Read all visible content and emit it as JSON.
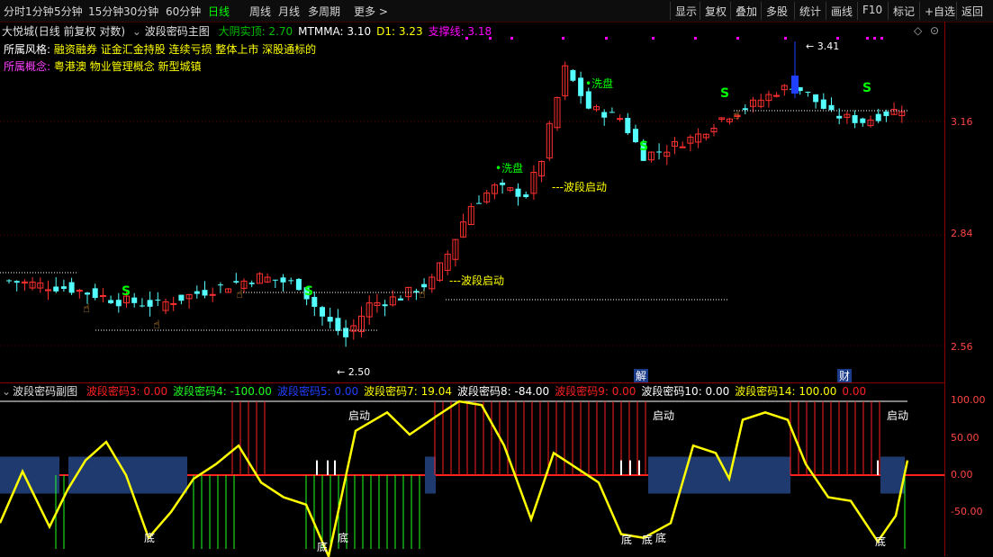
{
  "toolbar": {
    "left_items": [
      "分时",
      "1分钟",
      "5分钟",
      "15分钟",
      "30分钟",
      "60分钟",
      "日线",
      "周线",
      "月线",
      "多周期",
      "更多 >"
    ],
    "active": "日线",
    "right_items": [
      "显示",
      "复权",
      "叠加",
      "多股",
      "统计",
      "画线",
      "F10",
      "标记",
      "+自选",
      "返回"
    ]
  },
  "main": {
    "stock_name": "大悦城",
    "mode": "(日线 前复权 对数)",
    "indicator_name": "波段密码主图",
    "values": [
      {
        "label": "大阴实顶: 2.70",
        "color": "#00c000"
      },
      {
        "label": "MTMMA: 3.10",
        "color": "#ffffff"
      },
      {
        "label": "D1: 3.23",
        "color": "#ffff00"
      },
      {
        "label": "支撑线: 3.18",
        "color": "#ff00ff"
      }
    ],
    "style_label": "所属风格:",
    "style_value": "融资融券 证金汇金持股 连续亏损 整体上市 深股通标的",
    "concept_label": "所属概念:",
    "concept_value": "粤港澳 物业管理概念 新型城镇",
    "price_ticks": [
      "3.16",
      "2.84",
      "2.56"
    ],
    "high_label": "3.41",
    "low_label": "2.50",
    "annotations": {
      "start1": "---波段启动",
      "start2": "---波段启动",
      "wash1": "洗盘",
      "wash2": "洗盘",
      "s_mark": "S",
      "jie": "解",
      "cai": "财"
    }
  },
  "sub": {
    "title": "波段密码副图",
    "values": [
      {
        "label": "波段密码3: 0.00",
        "color": "#ff2020"
      },
      {
        "label": "波段密码4: -100.00",
        "color": "#20ff20"
      },
      {
        "label": "波段密码5: 0.00",
        "color": "#2040ff"
      },
      {
        "label": "波段密码7: 19.04",
        "color": "#ffff00"
      },
      {
        "label": "波段密码8: -84.00",
        "color": "#ffffff"
      },
      {
        "label": "波段密码9: 0.00",
        "color": "#ff2020"
      },
      {
        "label": "波段密码10: 0.00",
        "color": "#ffffff"
      },
      {
        "label": "波段密码14: 100.00",
        "color": "#ffff00"
      },
      {
        "label": "0.00",
        "color": "#ff2020"
      }
    ],
    "ticks": [
      "100.00",
      "50.00",
      "0.00",
      "-50.00"
    ],
    "start_label": "启动",
    "bottom_label": "底"
  },
  "chart_data": {
    "type": "candlestick",
    "price_axis_ticks": [
      3.16,
      2.84,
      2.56
    ],
    "high": 3.41,
    "low": 2.5,
    "oscillator": {
      "type": "line",
      "ticks": [
        100,
        50,
        0,
        -50
      ],
      "series_current": {
        "D1": 3.23,
        "MTMMA": 3.1,
        "support": 3.18
      }
    }
  },
  "colors": {
    "up": "#ff3030",
    "down": "#54ffff",
    "accent_green": "#00ff00",
    "grid_red": "#8b0000"
  }
}
